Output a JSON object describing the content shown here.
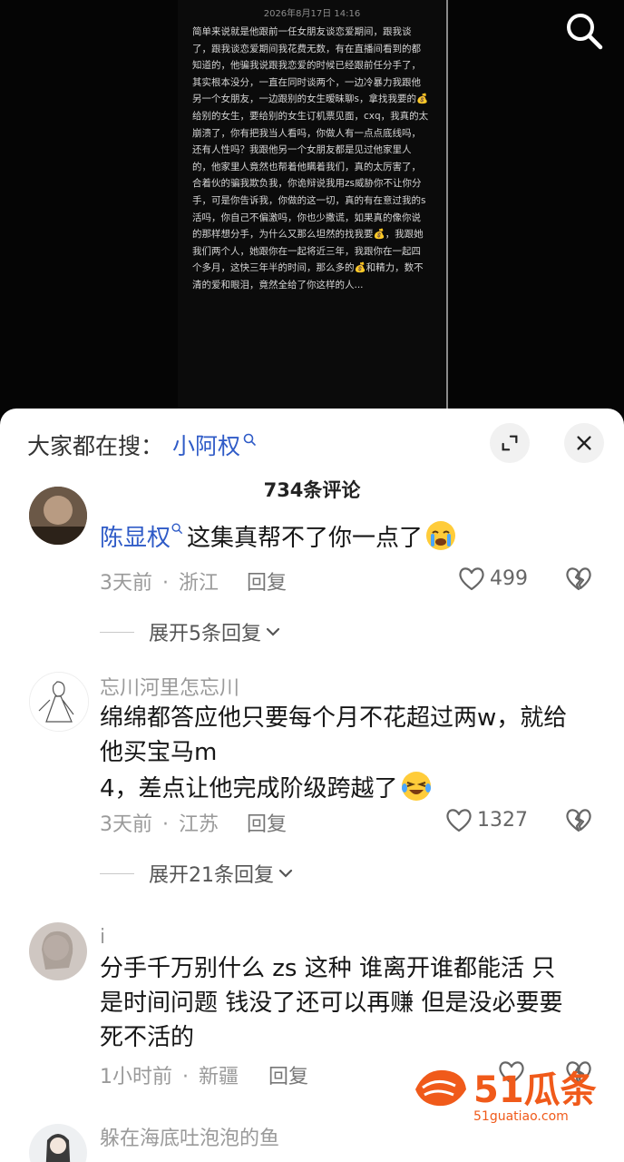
{
  "post": {
    "date": "2026年8月17日 14:16",
    "text": "简单来说就是他跟前一任女朋友谈恋爱期间，跟我谈了，跟我谈恋爱期间我花费无数，有在直播间看到的都知道的，他骗我说跟我恋爱的时候已经跟前任分手了，其实根本没分，一直在同时谈两个，一边冷暴力我跟他另一个女朋友，一边跟别的女生暧昧聊s，拿找我要的💰给别的女生，要给别的女生订机票见面，cxq，我真的太崩溃了，你有把我当人看吗，你做人有一点点底线吗，还有人性吗？我跟他另一个女朋友都是见过他家里人的，他家里人竟然也帮着他瞒着我们，真的太厉害了，合着伙的骗我欺负我，你诡辩说我用zs威胁你不让你分手，可是你告诉我，你做的这一切，真的有在意过我的s活吗，你自己不偏激吗，你也少撒谎，如果真的像你说的那样想分手，为什么又那么坦然的找我要💰，我跟她我们两个人，她跟你在一起将近三年，我跟你在一起四个多月，这快三年半的时间，那么多的💰和精力，数不清的爱和眼泪，竟然全给了你这样的人..."
  },
  "search_bar": {
    "prefix": "大家都在搜：",
    "keyword": "小阿权"
  },
  "comment_count": "734条评论",
  "comments": [
    {
      "mention": "陈显权",
      "text": "这集真帮不了你一点了",
      "time": "3天前",
      "location": "浙江",
      "reply": "回复",
      "likes": "499",
      "expand": "展开5条回复"
    },
    {
      "user": "忘川河里怎忘川",
      "line1": "绵绵都答应他只要每个月不花超过两w，就给",
      "line2": "他买宝马m",
      "line3": "4，差点让他完成阶级跨越了",
      "time": "3天前",
      "location": "江苏",
      "reply": "回复",
      "likes": "1327",
      "expand": "展开21条回复"
    },
    {
      "user": "i",
      "line1": "分手千万别什么 zs 这种 谁离开谁都能活 只",
      "line2": "是时间问题 钱没了还可以再赚 但是没必要要",
      "line3": "死不活的",
      "time": "1小时前",
      "location": "新疆",
      "reply": "回复"
    },
    {
      "user": "躲在海底吐泡泡的鱼"
    }
  ],
  "separator": "·",
  "watermark": {
    "text": "51瓜条",
    "url": "51guatiao.com"
  },
  "colors": {
    "link": "#2f5bc7",
    "watermark": "#f05a1a"
  }
}
